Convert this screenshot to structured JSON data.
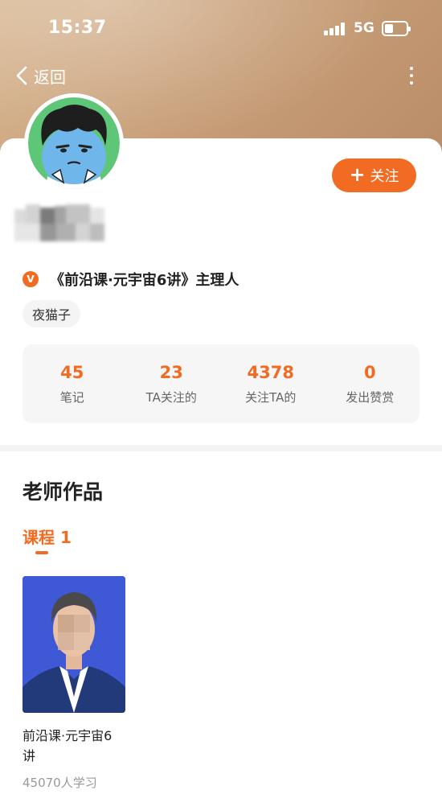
{
  "status_bar": {
    "time": "15:37",
    "network": "5G"
  },
  "nav": {
    "back_label": "返回"
  },
  "profile": {
    "follow_label": "关注",
    "title": "《前沿课·元宇宙6讲》主理人",
    "badge": "V",
    "tag": "夜猫子",
    "stats": [
      {
        "value": "45",
        "label": "笔记"
      },
      {
        "value": "23",
        "label": "TA关注的"
      },
      {
        "value": "4378",
        "label": "关注TA的"
      },
      {
        "value": "0",
        "label": "发出赞赏"
      }
    ]
  },
  "works": {
    "section_title": "老师作品",
    "tab_label": "课程 1",
    "courses": [
      {
        "title": "前沿课·元宇宙6讲",
        "students": "45070人学习"
      }
    ]
  },
  "colors": {
    "accent": "#f26b22",
    "hero": "#c9a07a",
    "cover_bg": "#3e58d6"
  }
}
